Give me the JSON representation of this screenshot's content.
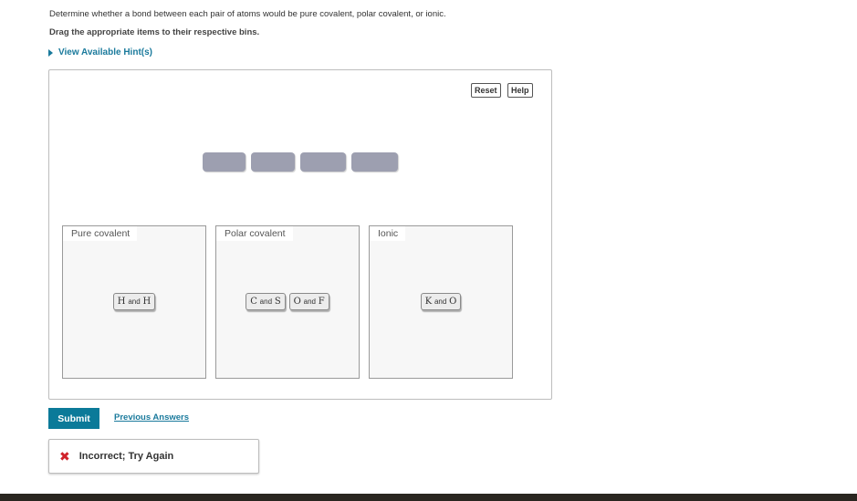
{
  "instructions": {
    "line1": "Determine whether a bond between each pair of atoms would be pure covalent, polar covalent, or ionic.",
    "line2": "Drag the appropriate items to their respective bins."
  },
  "hints": {
    "label": "View Available Hint(s)"
  },
  "toolbar": {
    "reset_label": "Reset",
    "help_label": "Help"
  },
  "bins": [
    {
      "label": "Pure covalent",
      "items": [
        {
          "a": "H",
          "and": "and",
          "b": "H"
        }
      ]
    },
    {
      "label": "Polar covalent",
      "items": [
        {
          "a": "C",
          "and": "and",
          "b": "S"
        },
        {
          "a": "O",
          "and": "and",
          "b": "F"
        }
      ]
    },
    {
      "label": "Ionic",
      "items": [
        {
          "a": "K",
          "and": "and",
          "b": "O"
        }
      ]
    }
  ],
  "actions": {
    "submit_label": "Submit",
    "previous_answers_label": "Previous Answers"
  },
  "feedback": {
    "icon": "x-icon",
    "message": "Incorrect; Try Again",
    "color": "#d0222a"
  }
}
